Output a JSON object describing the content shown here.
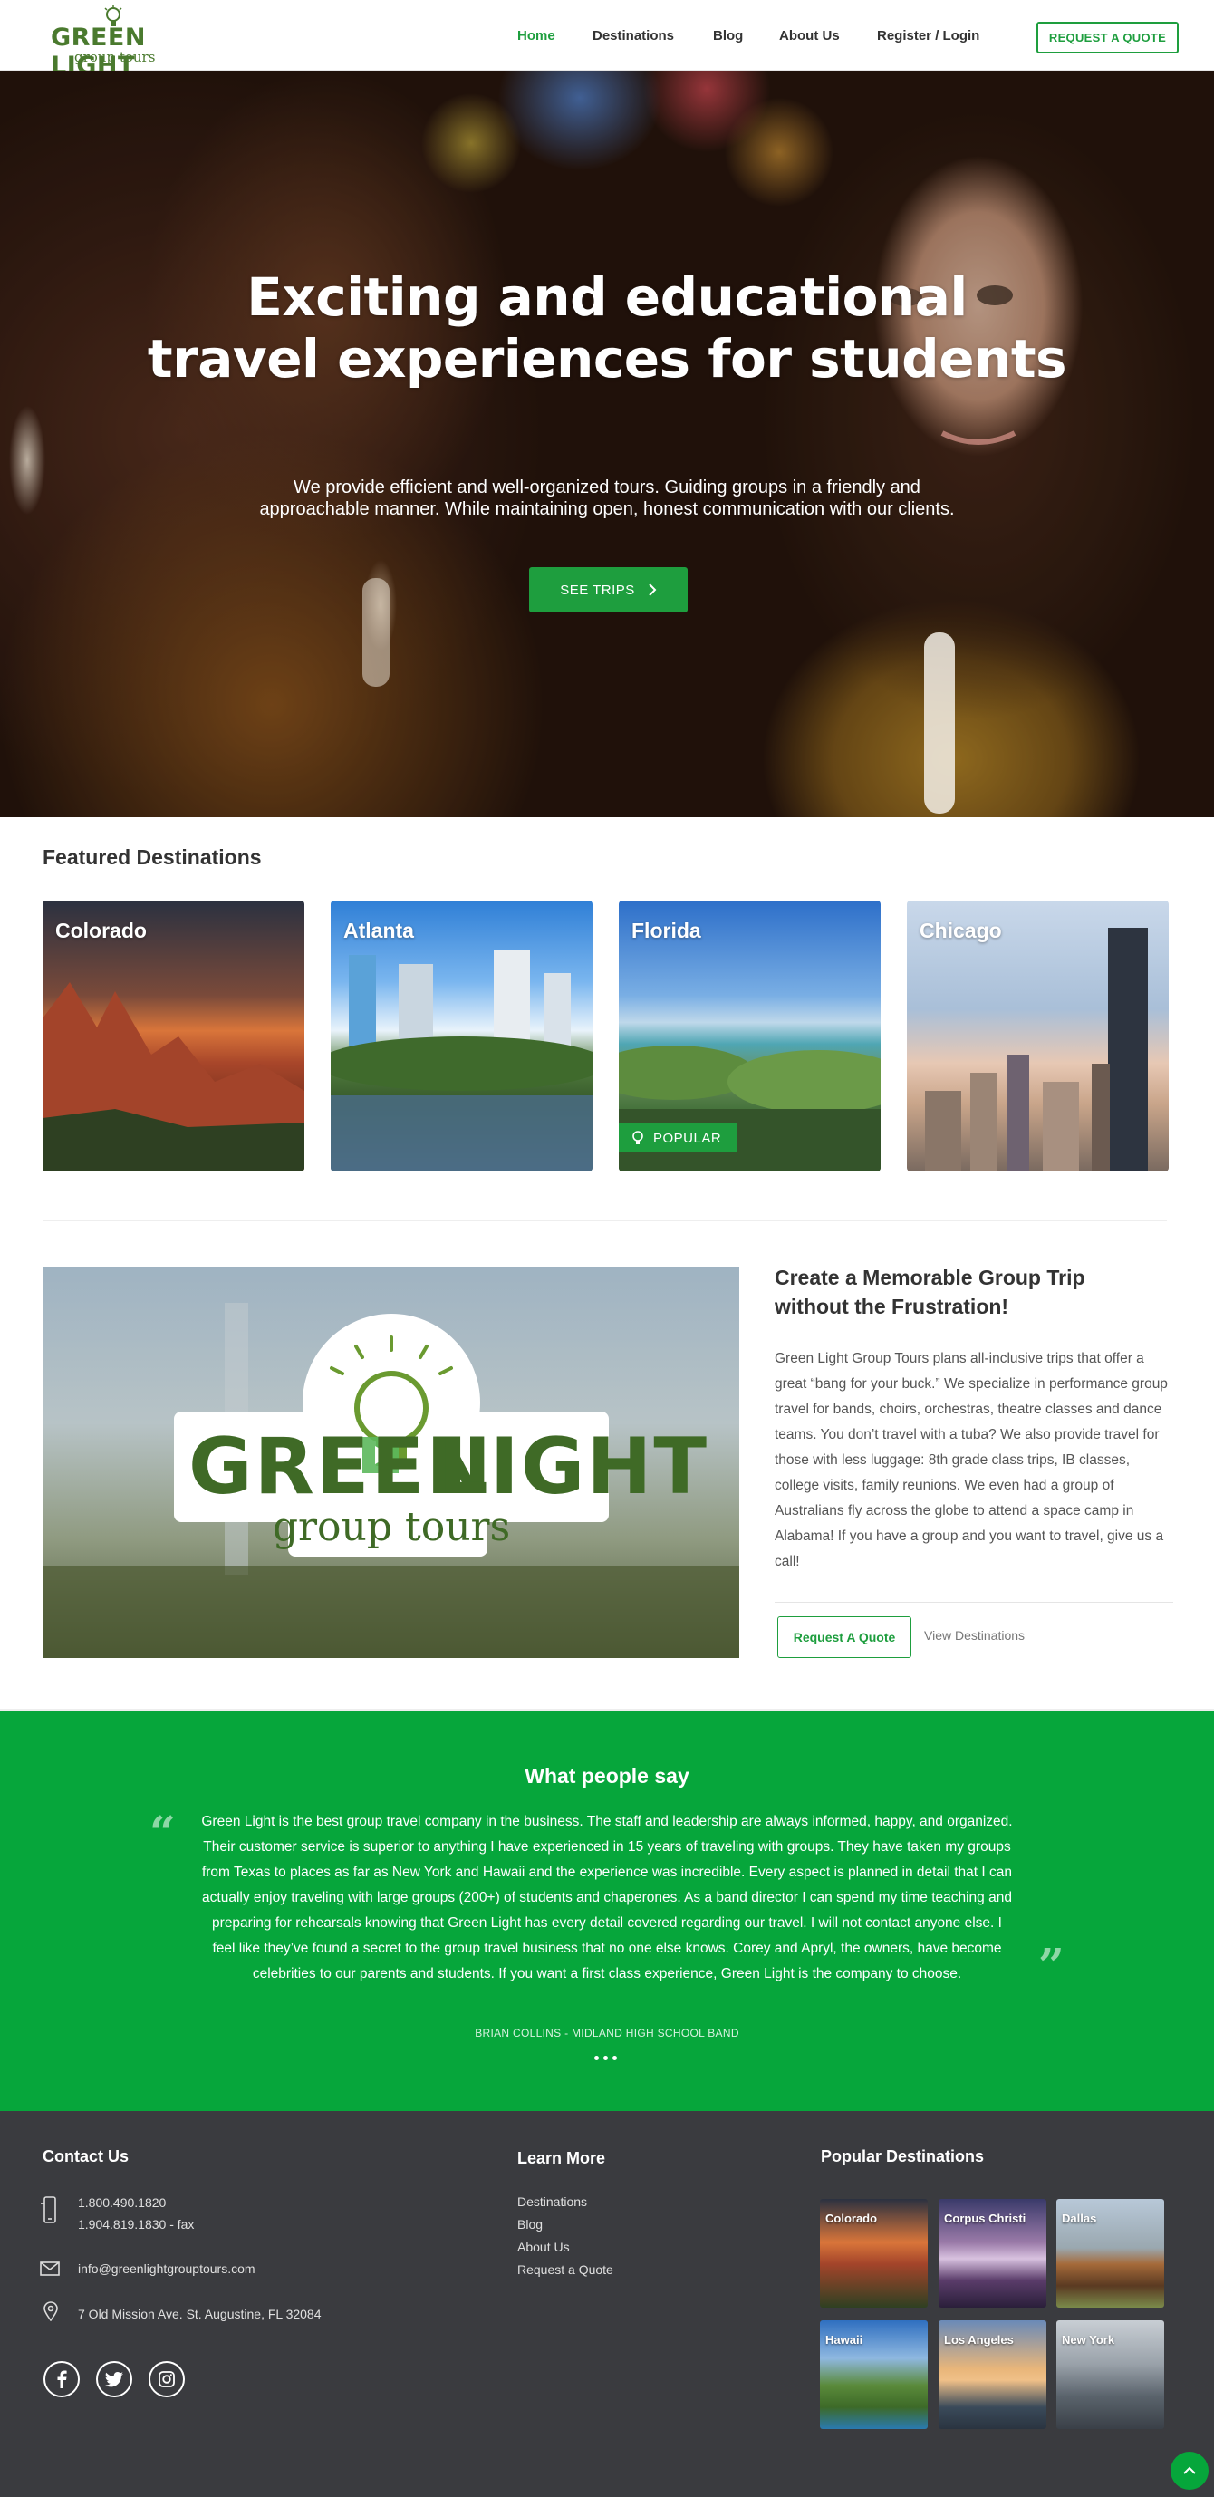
{
  "header": {
    "logo_word": "GREEN LIGHT",
    "logo_sub": "group tours",
    "nav": [
      {
        "label": "Home",
        "active": true
      },
      {
        "label": "Destinations",
        "active": false
      },
      {
        "label": "Blog",
        "active": false
      },
      {
        "label": "About Us",
        "active": false
      },
      {
        "label": "Register / Login",
        "active": false
      }
    ],
    "quote_button": "REQUEST A QUOTE"
  },
  "hero": {
    "title_line1": "Exciting and educational",
    "title_line2": "travel experiences for students",
    "subtitle_line1": "We provide efficient and well-organized tours. Guiding groups in a friendly and",
    "subtitle_line2": "approachable manner. While maintaining open, honest communication with our clients.",
    "button": "SEE TRIPS"
  },
  "featured": {
    "title": "Featured Destinations",
    "destinations": [
      {
        "name": "Colorado"
      },
      {
        "name": "Atlanta"
      },
      {
        "name": "Florida",
        "badge": "POPULAR"
      },
      {
        "name": "Chicago"
      }
    ]
  },
  "about": {
    "video_logo_word_left": "GREEN",
    "video_logo_word_right": "LIGHT",
    "video_logo_sub": "group tours",
    "title": "Create a Memorable Group Trip without the Frustration!",
    "text": "Green Light Group Tours plans all-inclusive trips that offer a great “bang for your buck.” We specialize in performance group travel for bands, choirs, orchestras, theatre classes and dance teams. You don’t travel with a tuba? We also provide travel for those with less luggage: 8th grade class trips, IB classes, college visits, family reunions. We even had a group of Australians fly across the globe to attend a space camp in Alabama! If you have a group and you want to travel, give us a call!",
    "button": "Request A Quote",
    "link": "View Destinations"
  },
  "testimonial": {
    "title": "What people say",
    "quote": "Green Light is the best group travel company in the business. The staff and leadership are always informed, happy, and organized. Their customer service is superior to anything I have experienced in 15 years of traveling with groups. They have taken my groups from Texas to places as far as New York and Hawaii and the experience was incredible. Every aspect is planned in detail that I can actually enjoy traveling with large groups (200+) of students and chaperones. As a band director I can spend my time teaching and preparing for rehearsals knowing that Green Light has every detail covered regarding our travel. I will not contact anyone else. I feel like they’ve found a secret to the group travel business that no one else knows. Corey and Apryl, the owners, have become celebrities to our parents and students. If you want a first class experience, Green Light is the company to choose.",
    "author": "BRIAN COLLINS - MIDLAND HIGH SCHOOL BAND",
    "open_mark": "“",
    "close_mark": "”"
  },
  "footer": {
    "contact_title": "Contact Us",
    "phone": "1.800.490.1820",
    "fax": "1.904.819.1830 - fax",
    "email": "info@greenlightgrouptours.com",
    "address": "7 Old Mission Ave. St. Augustine, FL 32084",
    "learn_title": "Learn More",
    "learn_links": [
      "Destinations",
      "Blog",
      "About Us",
      "Request a Quote"
    ],
    "popular_title": "Popular Destinations",
    "popular": [
      "Colorado",
      "Corpus Christi",
      "Dallas",
      "Hawaii",
      "Los Angeles",
      "New York"
    ],
    "social_icons": [
      "facebook-icon",
      "twitter-icon",
      "instagram-icon"
    ]
  },
  "colors": {
    "brand_green": "#1e9e3e",
    "testimonial_bg": "#06a63b",
    "footer_bg": "#3a3b3f"
  }
}
